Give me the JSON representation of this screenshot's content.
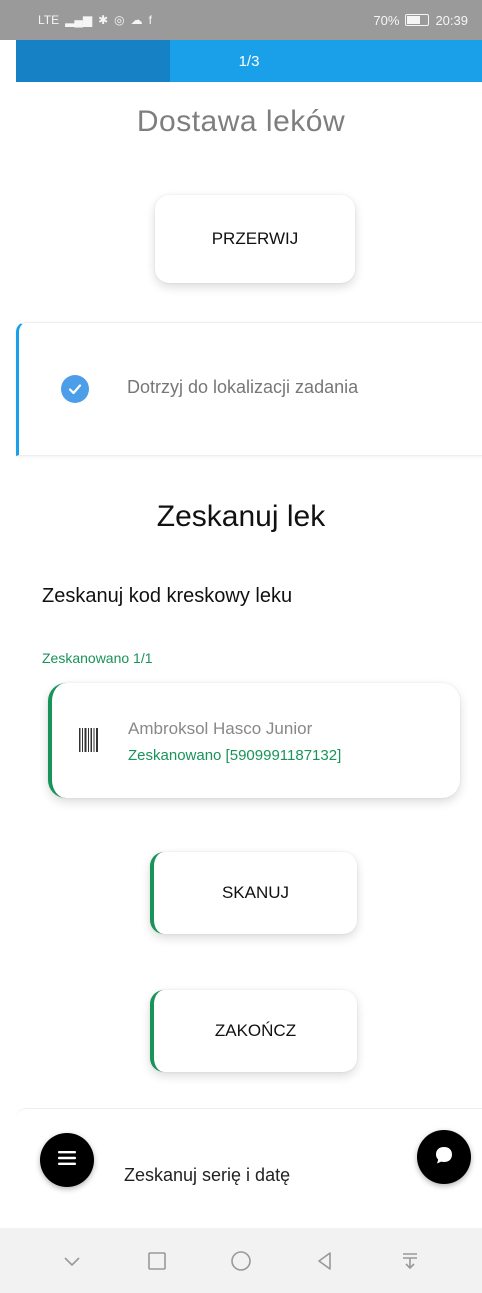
{
  "status_bar": {
    "network": "LTE",
    "battery_percent": "70%",
    "time": "20:39"
  },
  "progress": {
    "label": "1/3",
    "fraction": 0.33
  },
  "header": {
    "title": "Dostawa leków",
    "interrupt_label": "PRZERWIJ"
  },
  "steps": {
    "done_label": "Dotrzyj do lokalizacji zadania",
    "next_label": "Zeskanuj serię i datę"
  },
  "scan_section": {
    "title": "Zeskanuj lek",
    "subtitle": "Zeskanuj kod kreskowy leku",
    "counter": "Zeskanowano 1/1",
    "item": {
      "name": "Ambroksol Hasco Junior",
      "status": "Zeskanowano [5909991187132]"
    },
    "scan_button": "SKANUJ",
    "finish_button": "ZAKOŃCZ"
  },
  "icons": {
    "check": "check-icon",
    "barcode": "barcode-icon",
    "menu": "menu-icon",
    "chat": "chat-icon"
  },
  "colors": {
    "accent_blue": "#1aa0e8",
    "accent_green": "#18935a",
    "check_blue": "#4d9ee9"
  }
}
